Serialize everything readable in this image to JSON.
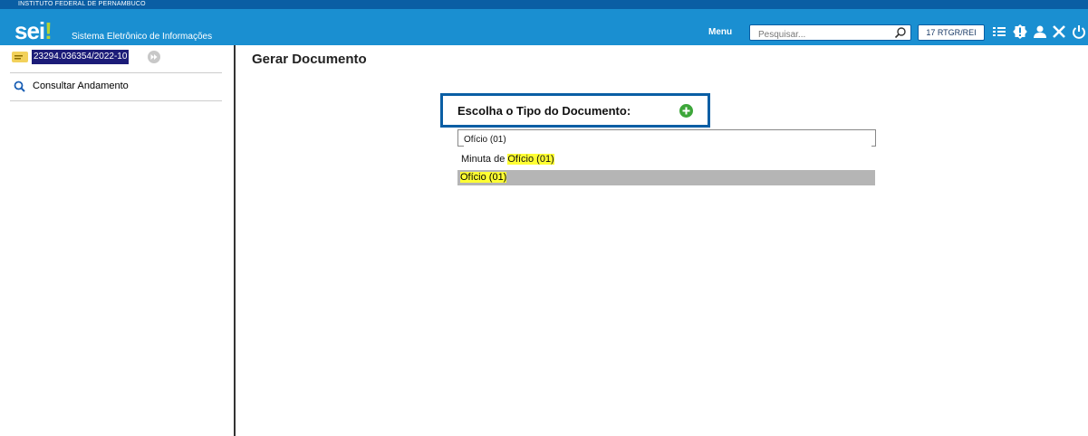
{
  "header": {
    "institution": "INSTITUTO FEDERAL DE PERNAMBUCO",
    "logo_text": "sei",
    "logo_mark": "!",
    "system_name": "Sistema Eletrônico de Informações",
    "menu_label": "Menu",
    "search_placeholder": "Pesquisar...",
    "unit_badge": "17 RTGR/REI",
    "icons": [
      "search-icon",
      "list-icon",
      "alert-icon",
      "user-icon",
      "tools-icon",
      "power-icon"
    ],
    "colors": {
      "bar": "#1a8fd1",
      "strip": "#0a5ea4"
    }
  },
  "sidebar": {
    "process_number": "23294.036354/2022-10",
    "items": [
      {
        "label": "Consultar Andamento",
        "icon": "search-icon"
      }
    ]
  },
  "main": {
    "page_title": "Gerar Documento",
    "choose_label": "Escolha o Tipo do Documento:",
    "filter_value": "Ofício (01)",
    "results": [
      {
        "prefix": "Minuta de ",
        "match": "Ofício (01)"
      },
      {
        "prefix": "",
        "match": "Ofício (01)"
      }
    ]
  }
}
